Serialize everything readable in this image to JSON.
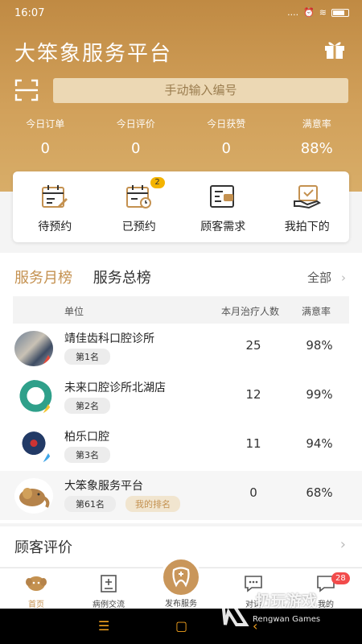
{
  "status": {
    "time": "16:07",
    "signal": "....",
    "battery": "5"
  },
  "header": {
    "title": "大笨象服务平台",
    "search_placeholder": "手动输入编号"
  },
  "stats": [
    {
      "label": "今日订单",
      "value": "0"
    },
    {
      "label": "今日评价",
      "value": "0"
    },
    {
      "label": "今日获赞",
      "value": "0"
    },
    {
      "label": "满意率",
      "value": "88%"
    }
  ],
  "quick": [
    {
      "label": "待预约",
      "icon": "calendar-pen-icon"
    },
    {
      "label": "已预约",
      "icon": "calendar-clock-icon",
      "badge": "2"
    },
    {
      "label": "顾客需求",
      "icon": "clipboard-chat-icon"
    },
    {
      "label": "我拍下的",
      "icon": "hand-tray-icon"
    }
  ],
  "ranking": {
    "tab_active": "服务月榜",
    "tab_other": "服务总榜",
    "all_label": "全部",
    "chevron": "›",
    "col_unit": "单位",
    "col_count": "本月治疗人数",
    "col_sat": "满意率",
    "rows": [
      {
        "name": "靖佳齿科口腔诊所",
        "rank": "第1名",
        "count": "25",
        "sat": "98%"
      },
      {
        "name": "未来口腔诊所北湖店",
        "rank": "第2名",
        "count": "12",
        "sat": "99%"
      },
      {
        "name": "柏乐口腔",
        "rank": "第3名",
        "count": "11",
        "sat": "94%"
      }
    ],
    "mine": {
      "name": "大笨象服务平台",
      "rank": "第61名",
      "mine_label": "我的排名",
      "count": "0",
      "sat": "68%"
    }
  },
  "review": {
    "label": "顾客评价",
    "chevron": "›"
  },
  "tabbar": [
    {
      "label": "首页",
      "icon": "elephant-home-icon"
    },
    {
      "label": "病例交流",
      "icon": "case-exchange-icon"
    },
    {
      "label": "发布服务",
      "icon": "tooth-plus-icon"
    },
    {
      "label": "对话",
      "icon": "chat-bubble-icon"
    },
    {
      "label": "我的",
      "icon": "profile-icon",
      "badge": "28"
    }
  ],
  "watermark": {
    "title": "扔玩游戏",
    "subtitle": "Rengwan Games"
  },
  "colors": {
    "accent": "#c49150",
    "hero": "#c08a43",
    "badge": "#f24b4b"
  }
}
